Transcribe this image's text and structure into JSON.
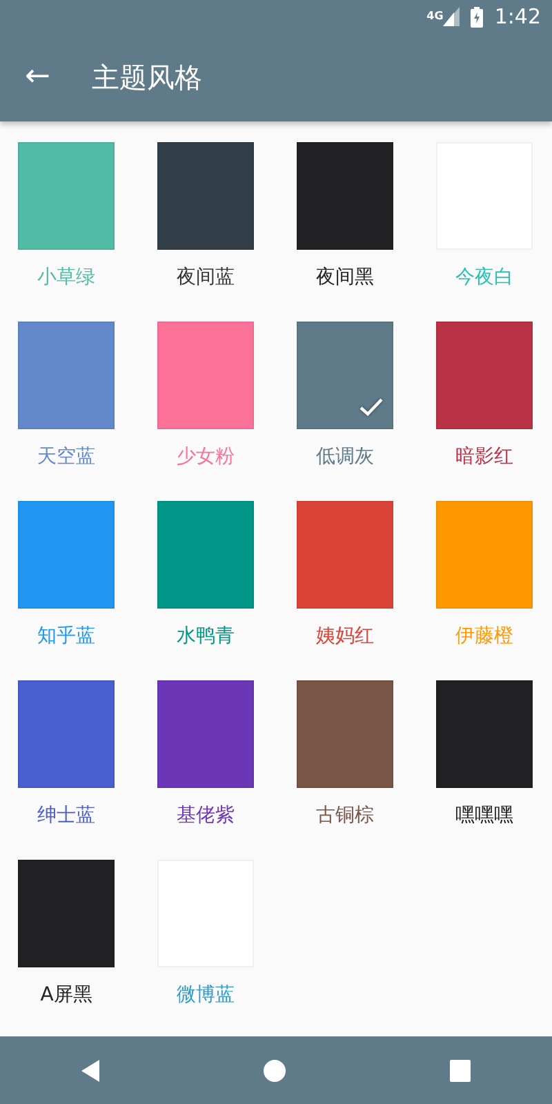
{
  "status_bar": {
    "network": "4G",
    "time": "1:42"
  },
  "toolbar": {
    "back": "←",
    "title": "主题风格"
  },
  "themes": [
    {
      "swatch": {
        "color": "#52bba5"
      },
      "label": {
        "text": "小草绿",
        "color": "#52bba5"
      },
      "selected": false
    },
    {
      "swatch": {
        "color": "#323e48"
      },
      "label": {
        "text": "夜间蓝",
        "color": "#333333"
      },
      "selected": false
    },
    {
      "swatch": {
        "color": "#212123"
      },
      "label": {
        "text": "夜间黑",
        "color": "#222222"
      },
      "selected": false
    },
    {
      "swatch": {
        "color": "#ffffff"
      },
      "label": {
        "text": "今夜白",
        "color": "#2bbfb3"
      },
      "selected": false
    },
    {
      "swatch": {
        "color": "#6189cc"
      },
      "label": {
        "text": "天空蓝",
        "color": "#6189cc"
      },
      "selected": false
    },
    {
      "swatch": {
        "color": "#fb7299"
      },
      "label": {
        "text": "少女粉",
        "color": "#fb7299"
      },
      "selected": false
    },
    {
      "swatch": {
        "color": "#5f7a88"
      },
      "label": {
        "text": "低调灰",
        "color": "#5f7a88"
      },
      "selected": true
    },
    {
      "swatch": {
        "color": "#b93246"
      },
      "label": {
        "text": "暗影红",
        "color": "#b93246"
      },
      "selected": false
    },
    {
      "swatch": {
        "color": "#2196f3"
      },
      "label": {
        "text": "知乎蓝",
        "color": "#2196f3"
      },
      "selected": false
    },
    {
      "swatch": {
        "color": "#009688"
      },
      "label": {
        "text": "水鸭青",
        "color": "#009688"
      },
      "selected": false
    },
    {
      "swatch": {
        "color": "#dc4338"
      },
      "label": {
        "text": "姨妈红",
        "color": "#dc4338"
      },
      "selected": false
    },
    {
      "swatch": {
        "color": "#ff9800"
      },
      "label": {
        "text": "伊藤橙",
        "color": "#ff9800"
      },
      "selected": false
    },
    {
      "swatch": {
        "color": "#4a5fcf"
      },
      "label": {
        "text": "绅士蓝",
        "color": "#4a5fcf"
      },
      "selected": false
    },
    {
      "swatch": {
        "color": "#6b37b7"
      },
      "label": {
        "text": "基佬紫",
        "color": "#6b37b7"
      },
      "selected": false
    },
    {
      "swatch": {
        "color": "#795548"
      },
      "label": {
        "text": "古铜棕",
        "color": "#795548"
      },
      "selected": false
    },
    {
      "swatch": {
        "color": "#212123"
      },
      "label": {
        "text": "嘿嘿嘿",
        "color": "#222222"
      },
      "selected": false
    },
    {
      "swatch": {
        "color": "#212123"
      },
      "label": {
        "text": "A屏黑",
        "color": "#222222"
      },
      "selected": false
    },
    {
      "swatch": {
        "color": "#ffffff"
      },
      "label": {
        "text": "微博蓝",
        "color": "#2d9bc9"
      },
      "selected": false
    }
  ]
}
